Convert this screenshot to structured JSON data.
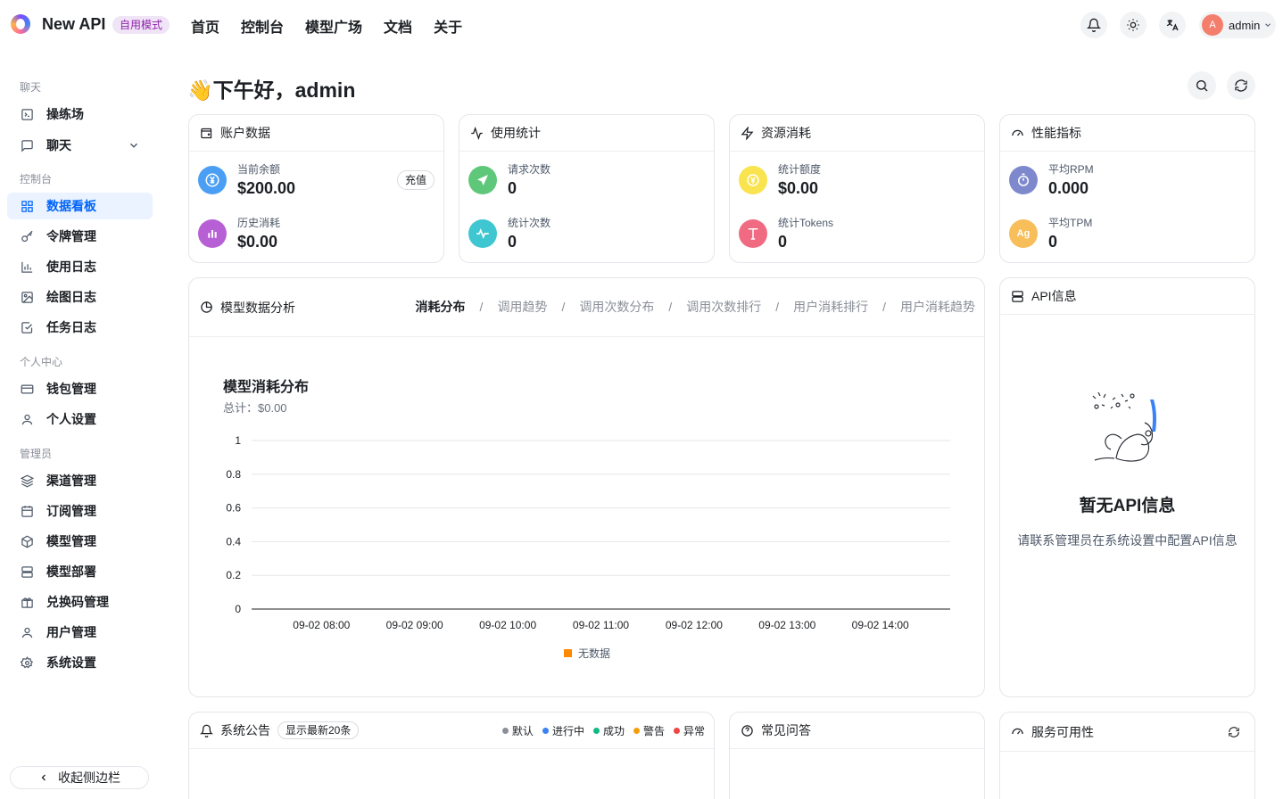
{
  "header": {
    "brand": "New API",
    "mode_tag": "自用模式",
    "nav": [
      "首页",
      "控制台",
      "模型广场",
      "文档",
      "关于"
    ],
    "user": {
      "avatar_letter": "A",
      "name": "admin"
    }
  },
  "sidebar": {
    "sections": {
      "chat": "聊天",
      "console": "控制台",
      "personal": "个人中心",
      "admin": "管理员"
    },
    "items": {
      "playground": "操练场",
      "chat": "聊天",
      "dashboard": "数据看板",
      "tokens": "令牌管理",
      "usage_log": "使用日志",
      "drawing_log": "绘图日志",
      "task_log": "任务日志",
      "wallet": "钱包管理",
      "profile": "个人设置",
      "channels": "渠道管理",
      "subscriptions": "订阅管理",
      "models": "模型管理",
      "deployments": "模型部署",
      "redemption": "兑换码管理",
      "users": "用户管理",
      "settings": "系统设置"
    },
    "collapse_label": "收起侧边栏"
  },
  "main": {
    "greeting": "👋下午好，admin",
    "account": {
      "title": "账户数据",
      "balance_label": "当前余额",
      "balance_value": "$200.00",
      "recharge": "充值",
      "history_label": "历史消耗",
      "history_value": "$0.00"
    },
    "usage": {
      "title": "使用统计",
      "requests_label": "请求次数",
      "requests_value": "0",
      "count_label": "统计次数",
      "count_value": "0"
    },
    "resource": {
      "title": "资源消耗",
      "quota_label": "统计额度",
      "quota_value": "$0.00",
      "tokens_label": "统计Tokens",
      "tokens_value": "0"
    },
    "performance": {
      "title": "性能指标",
      "rpm_label": "平均RPM",
      "rpm_value": "0.000",
      "tpm_label": "平均TPM",
      "tpm_value": "0",
      "tpm_badge": "Ag"
    },
    "analysis": {
      "title": "模型数据分析",
      "tabs": [
        "消耗分布",
        "调用趋势",
        "调用次数分布",
        "调用次数排行",
        "用户消耗排行",
        "用户消耗趋势"
      ],
      "chart_title": "模型消耗分布",
      "chart_subtitle": "总计：$0.00"
    },
    "api_info": {
      "title": "API信息",
      "empty_title": "暂无API信息",
      "empty_desc": "请联系管理员在系统设置中配置API信息"
    },
    "notice": {
      "title": "系统公告",
      "tag": "显示最新20条",
      "legend": [
        {
          "label": "默认",
          "color": "#8a8f98"
        },
        {
          "label": "进行中",
          "color": "#3b82f6"
        },
        {
          "label": "成功",
          "color": "#10b981"
        },
        {
          "label": "警告",
          "color": "#f59e0b"
        },
        {
          "label": "异常",
          "color": "#ef4444"
        }
      ]
    },
    "faq": {
      "title": "常见问答"
    },
    "availability": {
      "title": "服务可用性"
    }
  },
  "chart_data": {
    "type": "bar",
    "title": "模型消耗分布",
    "subtitle": "总计：$0.00",
    "categories": [
      "09-02 08:00",
      "09-02 09:00",
      "09-02 10:00",
      "09-02 11:00",
      "09-02 12:00",
      "09-02 13:00",
      "09-02 14:00"
    ],
    "series": [
      {
        "name": "无数据",
        "values": [
          0,
          0,
          0,
          0,
          0,
          0,
          0
        ],
        "color": "#ff8a00"
      }
    ],
    "y_ticks": [
      "0",
      "0.2",
      "0.4",
      "0.6",
      "0.8",
      "1"
    ],
    "ylim": [
      0,
      1
    ],
    "grid": true,
    "legend_position": "bottom"
  }
}
